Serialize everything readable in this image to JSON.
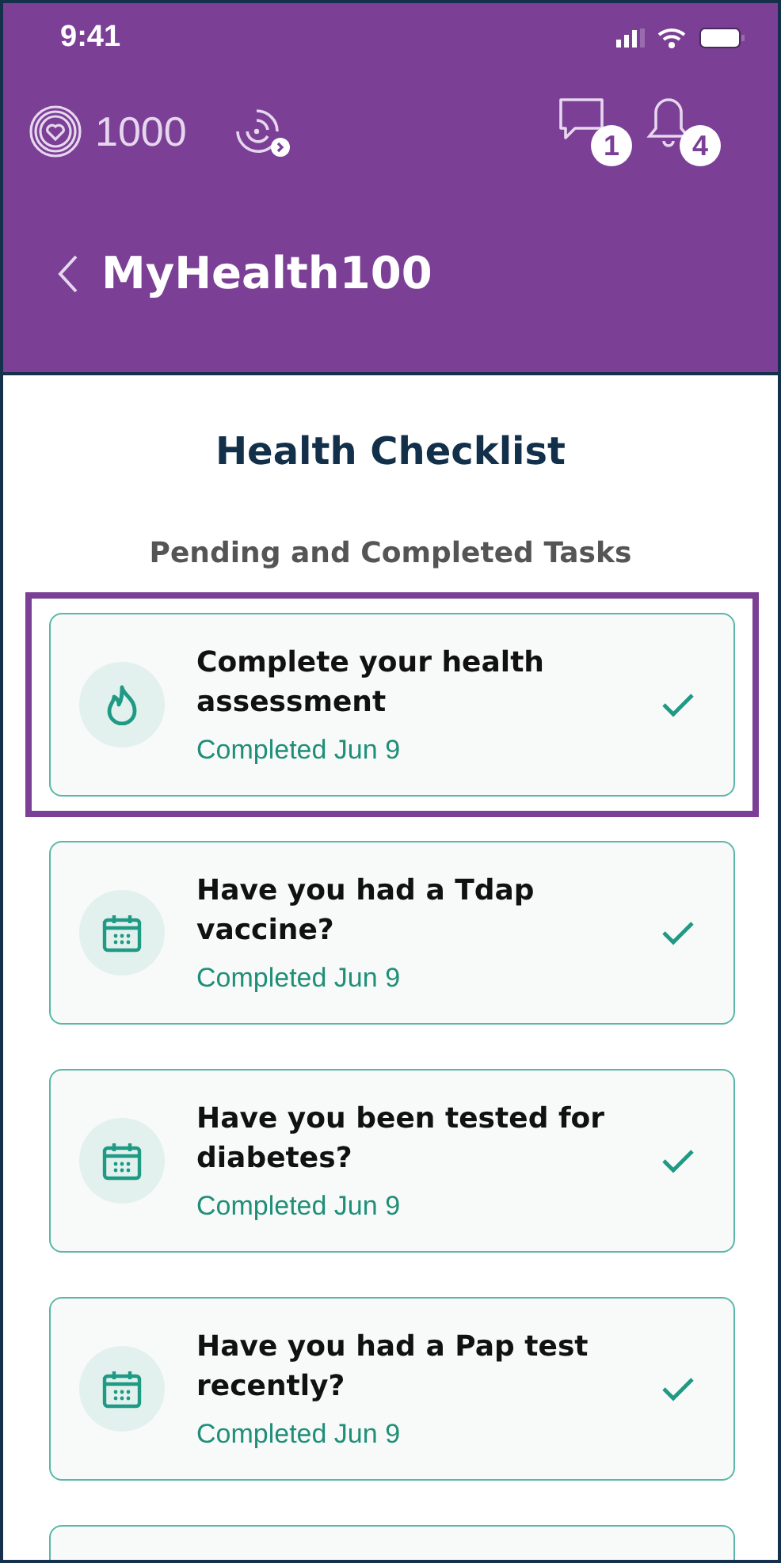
{
  "status_bar": {
    "time": "9:41"
  },
  "top_bar": {
    "points": "1000",
    "messages_badge": "1",
    "notifications_badge": "4"
  },
  "header": {
    "title": "MyHealth100"
  },
  "page": {
    "title": "Health Checklist",
    "section_title": "Pending and Completed Tasks"
  },
  "tasks": [
    {
      "kind": "assessment",
      "title": "Complete your health assessment",
      "status": "Completed Jun 9",
      "completed": true,
      "selected": true
    },
    {
      "kind": "calendar",
      "title": "Have you had a Tdap vaccine?",
      "status": "Completed Jun 9",
      "completed": true,
      "selected": false
    },
    {
      "kind": "calendar",
      "title": "Have you been tested for diabetes?",
      "status": "Completed Jun 9",
      "completed": true,
      "selected": false
    },
    {
      "kind": "calendar",
      "title": "Have you had a Pap test recently?",
      "status": "Completed Jun 9",
      "completed": true,
      "selected": false
    }
  ]
}
